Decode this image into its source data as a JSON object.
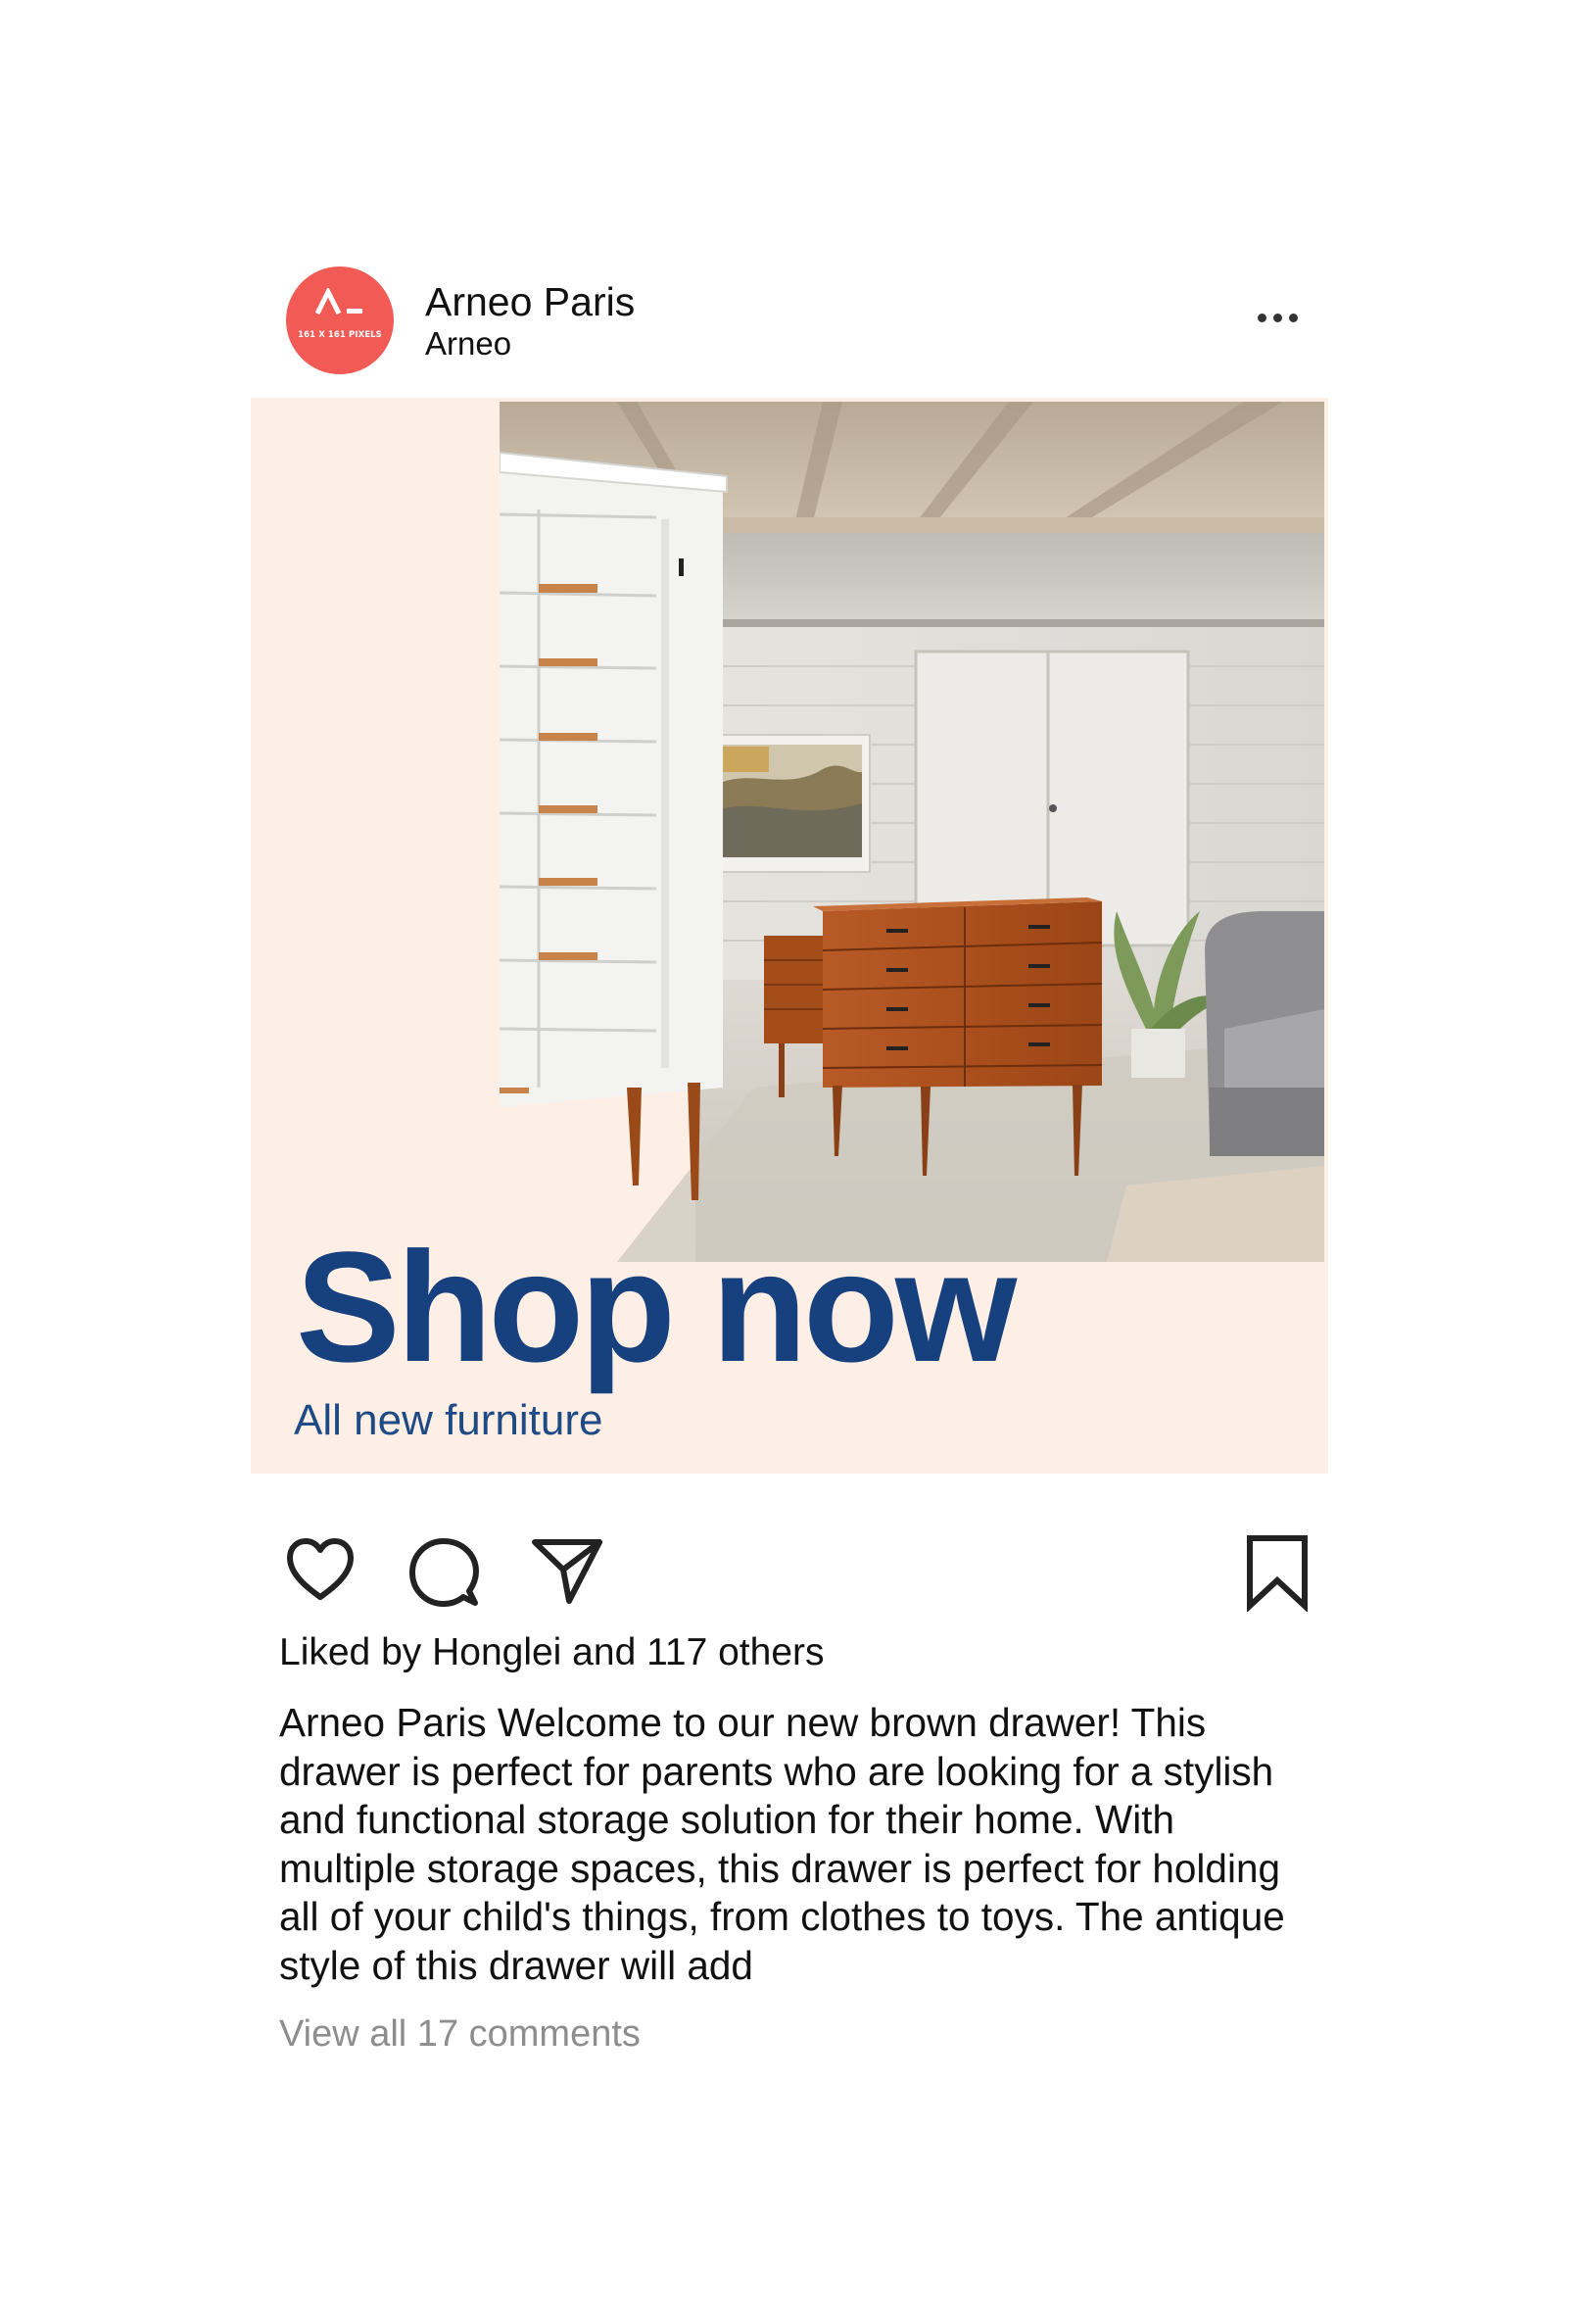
{
  "account": {
    "name": "Arneo Paris",
    "subtitle": "Arneo",
    "avatar_caption": "161 X 161 PIXELS",
    "avatar_color": "#f25a55"
  },
  "ad": {
    "headline": "Shop now",
    "subheadline": "All new furniture",
    "background_color": "#feefe6",
    "headline_color": "#16407e"
  },
  "actions": {
    "icons": [
      "heart-icon",
      "comment-icon",
      "send-icon",
      "bookmark-icon"
    ]
  },
  "likes_text": "Liked by Honglei and 117 others",
  "caption": {
    "author": "Arneo Paris",
    "text": "Welcome to our new brown drawer! This drawer is perfect for parents who are looking for a stylish and functional storage solution for their home. With multiple storage spaces, this drawer is perfect for holding all of your child's things, from clothes to toys. The antique style of this drawer will add"
  },
  "comments_link": "View all 17 comments"
}
